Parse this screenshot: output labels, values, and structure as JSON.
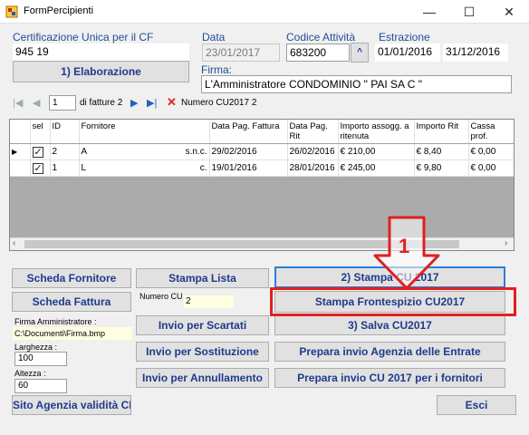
{
  "window": {
    "title": "FormPercipienti",
    "minimize": "—",
    "maximize": "☐",
    "close": "✕"
  },
  "cert": {
    "label": "Certificazione Unica per il CF",
    "value": "945          19",
    "elaborazione_label": "1) Elaborazione"
  },
  "data": {
    "label": "Data",
    "value": "23/01/2017"
  },
  "codice": {
    "label": "Codice Attività",
    "value": "683200",
    "spin": "^"
  },
  "estrazione": {
    "label": "Estrazione",
    "from": "01/01/2016",
    "to": "31/12/2016"
  },
  "firma": {
    "label": "Firma:",
    "value": "L'Amministratore CONDOMINIO \" PAI              SA C \""
  },
  "navigator": {
    "first": "|◀",
    "prev": "◀",
    "position": "1",
    "of_label": "di fatture 2",
    "next": "▶",
    "last": "▶|",
    "delete": "✕",
    "numero_label": "Numero CU2017  2"
  },
  "grid": {
    "columns": [
      "",
      "sel",
      "ID",
      "Fornitore",
      "Data Pag. Fattura",
      "Data Pag. Rit",
      "Importo assogg. a ritenuta",
      "Importo Rit",
      "Cassa prof."
    ],
    "rows": [
      {
        "marker": "▶",
        "sel": true,
        "id": "2",
        "fornitore": "A",
        "fornitore_suffix": "s.n.c.",
        "data_fatt": "29/02/2016",
        "data_rit": "26/02/2016",
        "importo": "€ 210,00",
        "rit": "€ 8,40",
        "cassa": "€ 0,00"
      },
      {
        "marker": "",
        "sel": true,
        "id": "1",
        "fornitore": "L",
        "fornitore_suffix": "c.",
        "data_fatt": "19/01/2016",
        "data_rit": "28/01/2016",
        "importo": "€ 245,00",
        "rit": "€ 9,80",
        "cassa": "€ 0,00"
      }
    ]
  },
  "buttons": {
    "scheda_fornitore": "Scheda Fornitore",
    "scheda_fattura": "Scheda Fattura",
    "stampa_lista": "Stampa Lista",
    "stampa_cu": "2) Stampa CU 2017",
    "stampa_frontespizio": "Stampa Frontespizio CU2017",
    "invio_scartati": "Invio per Scartati",
    "salva_cu": "3) Salva CU2017",
    "invio_sostituzione": "Invio per Sostituzione",
    "prepara_agenzia": "Prepara  invio Agenzia delle Entrate",
    "invio_annullamento": "Invio per Annullamento",
    "prepara_fornitori": "Prepara invio CU 2017 per i fornitori",
    "sito_agenzia": "Sito Agenzia validità CF",
    "esci": "Esci"
  },
  "numero_cu": {
    "label": "Numero CU",
    "value": "2"
  },
  "firma_amm": {
    "label": "Firma Amministratore :",
    "value": "C:\\Documenti\\Firma.bmp"
  },
  "larghezza": {
    "label": "Larghezza :",
    "value": "100"
  },
  "altezza": {
    "label": "Altezza :",
    "value": "60"
  },
  "annotation": {
    "number": "1",
    "color": "#e02020"
  }
}
